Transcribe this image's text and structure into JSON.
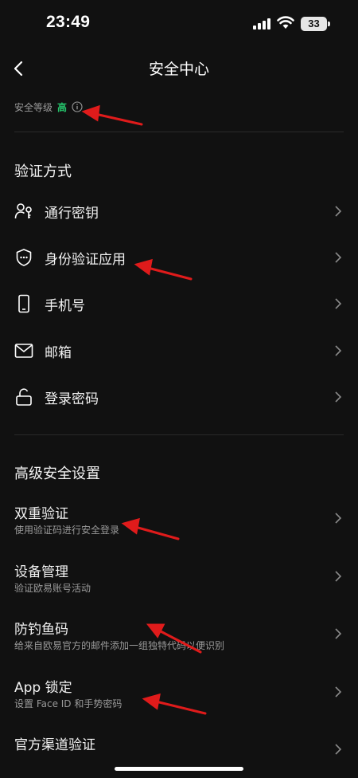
{
  "status": {
    "time": "23:49",
    "battery": "33"
  },
  "nav": {
    "title": "安全中心"
  },
  "security_level": {
    "label": "安全等级",
    "value": "高"
  },
  "auth_methods": {
    "title": "验证方式",
    "items": [
      {
        "label": "通行密钥",
        "icon": "passkey-icon"
      },
      {
        "label": "身份验证应用",
        "icon": "shield-icon"
      },
      {
        "label": "手机号",
        "icon": "phone-icon"
      },
      {
        "label": "邮箱",
        "icon": "mail-icon"
      },
      {
        "label": "登录密码",
        "icon": "lock-icon"
      }
    ]
  },
  "advanced": {
    "title": "高级安全设置",
    "items": [
      {
        "label": "双重验证",
        "sub": "使用验证码进行安全登录"
      },
      {
        "label": "设备管理",
        "sub": "验证欧易账号活动"
      },
      {
        "label": "防钓鱼码",
        "sub": "给来自欧易官方的邮件添加一组独特代码以便识别"
      },
      {
        "label": "App 锁定",
        "sub": "设置 Face ID 和手势密码"
      },
      {
        "label": "官方渠道验证",
        "sub": ""
      }
    ]
  },
  "colors": {
    "background": "#111111",
    "accent_green": "#25c36b",
    "annotation_red": "#e01b1b"
  }
}
